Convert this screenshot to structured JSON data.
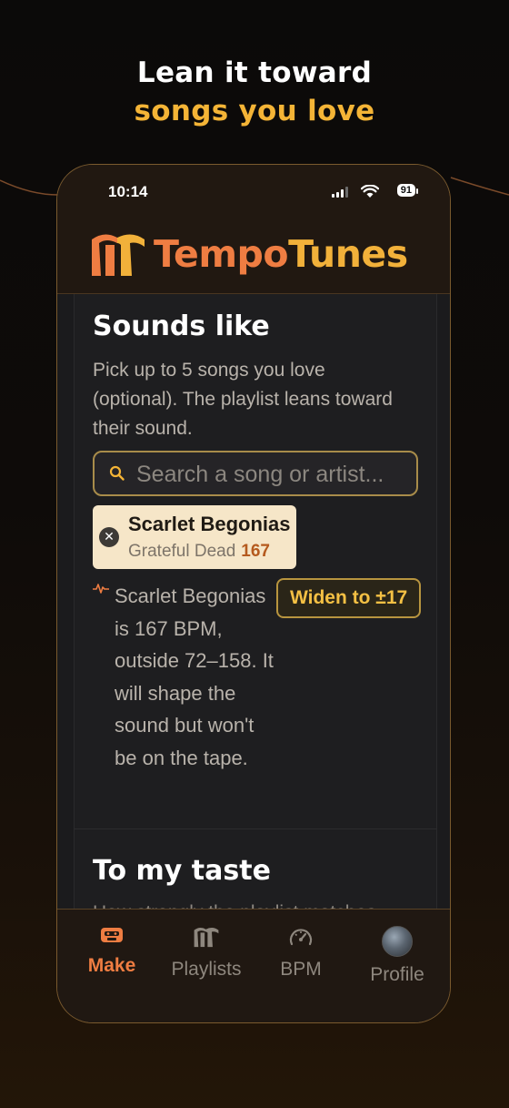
{
  "headline": {
    "line1": "Lean it toward",
    "line2": "songs you love"
  },
  "status_bar": {
    "time": "10:14",
    "battery": "91"
  },
  "app": {
    "logo_tempo": "Tempo",
    "logo_tunes": "Tunes"
  },
  "sounds_like": {
    "title": "Sounds like",
    "description": "Pick up to 5 songs you love (optional). The playlist leans toward their sound.",
    "search_placeholder": "Search a song or artist...",
    "selected_song": {
      "title": "Scarlet Begonias",
      "artist": "Grateful Dead",
      "bpm": "167"
    },
    "warning": "Scarlet Begonias is 167 BPM, outside 72–158. It will shape the sound but won't be on the tape.",
    "widen_label": "Widen to ±17"
  },
  "to_my_taste": {
    "title": "To my taste",
    "description": "How strongly the playlist matches"
  },
  "tabs": [
    {
      "label": "Make",
      "icon": "cassette-icon",
      "active": true
    },
    {
      "label": "Playlists",
      "icon": "logo-icon",
      "active": false
    },
    {
      "label": "BPM",
      "icon": "speedometer-icon",
      "active": false
    },
    {
      "label": "Profile",
      "icon": "avatar",
      "active": false
    }
  ],
  "colors": {
    "accent_orange": "#ef7d42",
    "accent_yellow": "#f4b436",
    "chip_bg": "#f6e6c8",
    "background": "#0b0a09"
  }
}
